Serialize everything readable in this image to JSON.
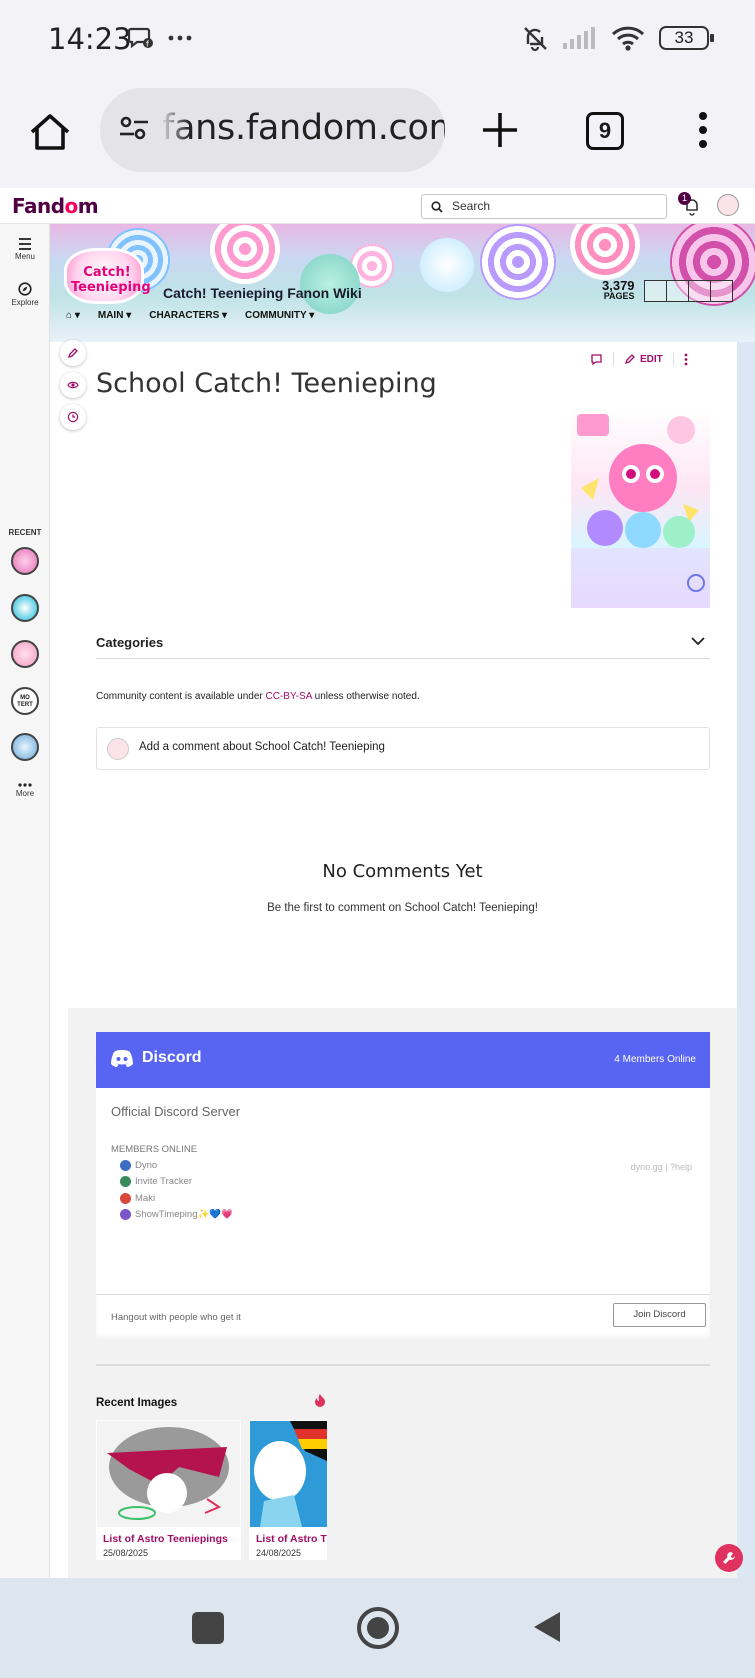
{
  "status_bar": {
    "time": "14:23",
    "battery": "33",
    "left_icons": [
      "chat-bubble-icon",
      "ellipsis-icon"
    ],
    "right_icons": [
      "muted-bell-icon",
      "signal-icon",
      "wifi-icon",
      "battery-icon"
    ]
  },
  "browser": {
    "url": "fans.fandom.com",
    "tab_count": "9"
  },
  "fandom": {
    "logo_text_a": "Fand",
    "logo_text_o": "o",
    "logo_text_b": "m",
    "search_placeholder": "Search",
    "notification_count": "1"
  },
  "rail": {
    "menu_label": "Menu",
    "explore_label": "Explore",
    "recent_label": "RECENT",
    "more_label": "More",
    "recent_av_4_text": "MO\nTERT"
  },
  "wiki": {
    "logo_text": "Catch! Teenieping",
    "name": "Catch! Teenieping Fanon Wiki",
    "pages_count": "3,379",
    "pages_label": "PAGES",
    "nav": [
      "MAIN",
      "CHARACTERS",
      "COMMUNITY"
    ]
  },
  "article": {
    "title": "School Catch! Teenieping",
    "edit_label": "EDIT",
    "categories_label": "Categories",
    "license_prefix": "Community content is available under ",
    "license_link": "CC-BY-SA",
    "license_suffix": " unless otherwise noted."
  },
  "comments": {
    "add_prompt": "Add a comment about School Catch! Teenieping",
    "empty_title": "No Comments Yet",
    "empty_sub": "Be the first to comment on School Catch! Teenieping!"
  },
  "discord": {
    "brand": "Discord",
    "online": "4 Members Online",
    "server_name": "Official Discord Server",
    "members_title": "MEMBERS ONLINE",
    "members": [
      "Dyno",
      "Invite Tracker",
      "Maki",
      "ShowTimeping✨💙💗"
    ],
    "member_colors": [
      "#3c6fc4",
      "#3a8b5c",
      "#d9483b",
      "#7b55c9"
    ],
    "bot_links": "dyno.gg | ?help",
    "footer_text": "Hangout with people who get it",
    "join_label": "Join Discord"
  },
  "recent_images": {
    "title": "Recent Images",
    "items": [
      {
        "caption": "List of Astro Teeniepings",
        "date": "25/08/2025"
      },
      {
        "caption": "List of Astro T",
        "date": "24/08/2025"
      }
    ]
  },
  "colors": {
    "fandom_purple": "#520044",
    "fandom_pink": "#fa005a",
    "link": "#a00f67",
    "discord_blurple": "#5865f2"
  }
}
